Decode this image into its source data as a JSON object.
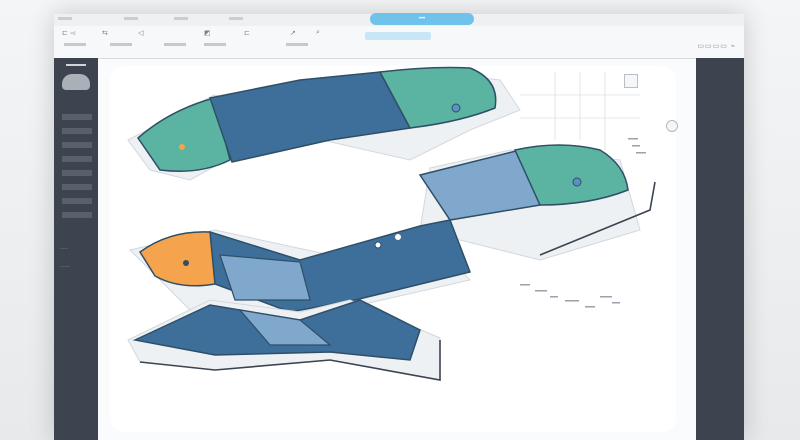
{
  "window": {
    "tab_label": "•••",
    "brand": "▭▭▭▭ ⌁",
    "toolbar_glyphs": [
      "⊏ ◅",
      "⇆",
      "◁",
      "◩",
      "⊏",
      "↗",
      "⌕"
    ]
  },
  "sidebar": {
    "items": 8,
    "labels": [
      "∙∙∙∙∙∙",
      "∙∙∙∙∙∙∙"
    ]
  },
  "colors": {
    "blue": "#3d6f9a",
    "light_blue": "#7fa8cc",
    "teal": "#5ab4a1",
    "orange": "#f5a34d",
    "sidebar": "#3d4450"
  },
  "icons": [
    "user-avatar-icon",
    "search-field-icon",
    "settings-knob-icon"
  ]
}
